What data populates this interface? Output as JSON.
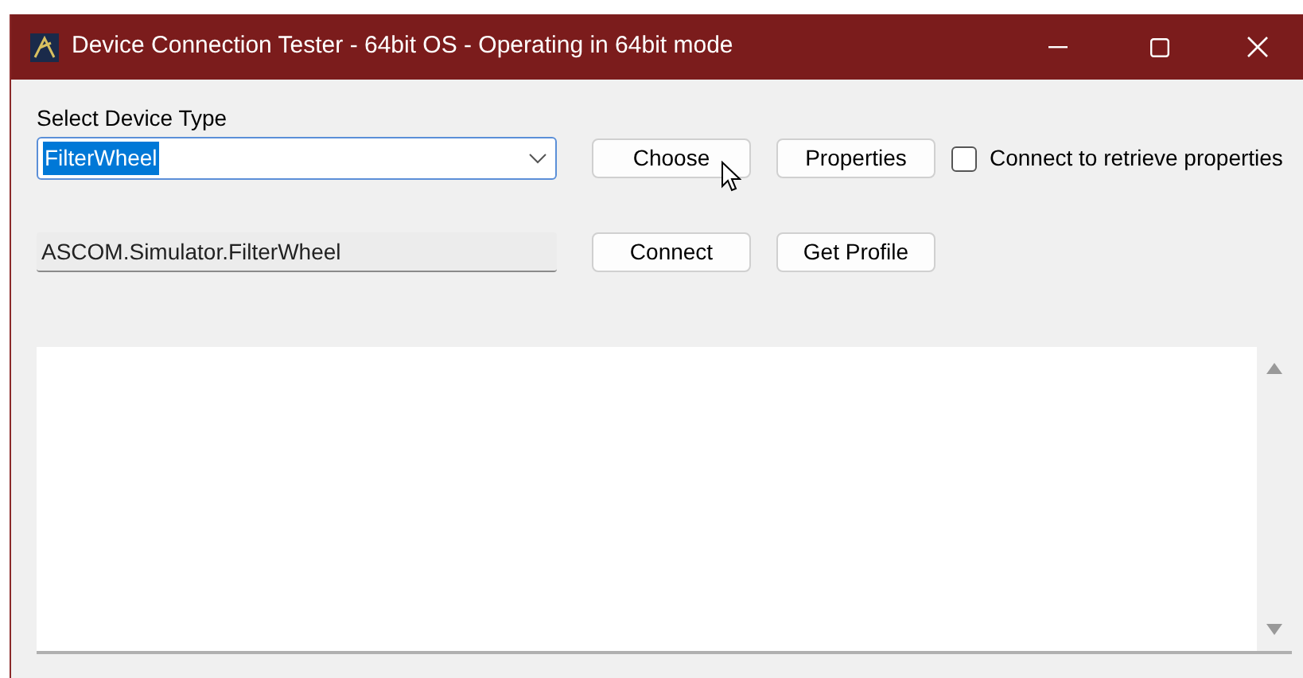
{
  "window": {
    "title": "Device Connection Tester - 64bit OS - Operating in 64bit mode"
  },
  "device_type": {
    "label": "Select Device Type",
    "value": "FilterWheel",
    "text_selected": true
  },
  "prog_id": {
    "value": "ASCOM.Simulator.FilterWheel"
  },
  "buttons_row_1": [
    {
      "label": "Choose"
    },
    {
      "label": "Properties"
    }
  ],
  "connect_checkbox": {
    "label": "Connect to retrieve properties",
    "checked": false
  },
  "buttons_row_2": [
    {
      "label": "Connect"
    },
    {
      "label": "Get Profile"
    }
  ]
}
